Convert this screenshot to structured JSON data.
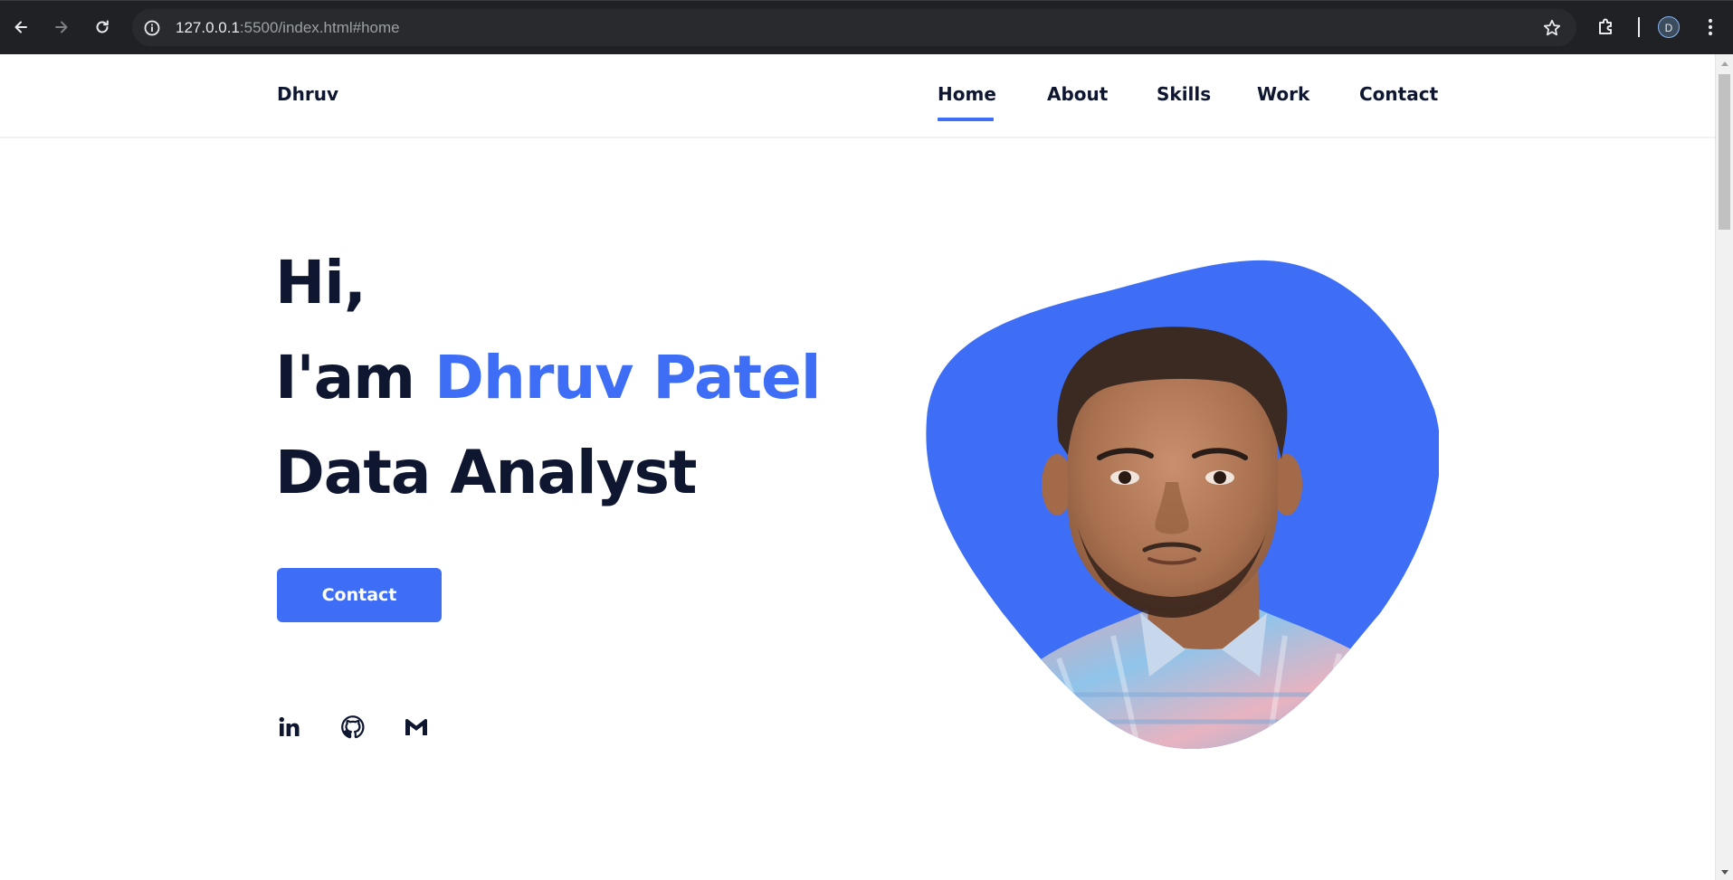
{
  "browser": {
    "url_host": "127.0.0.1",
    "url_rest": ":5500/index.html#home",
    "profile_initial": "D"
  },
  "site": {
    "logo": "Dhruv",
    "nav": [
      {
        "label": "Home",
        "active": true
      },
      {
        "label": "About",
        "active": false
      },
      {
        "label": "Skills",
        "active": false
      },
      {
        "label": "Work",
        "active": false
      },
      {
        "label": "Contact",
        "active": false
      }
    ]
  },
  "hero": {
    "greeting": "Hi,",
    "intro_prefix": "I'am ",
    "name": "Dhruv Patel",
    "role": "Data Analyst",
    "cta_label": "Contact",
    "social": [
      "linkedin-icon",
      "github-icon",
      "gmail-icon"
    ]
  },
  "colors": {
    "accent": "#3d6ef5",
    "text_dark": "#0e1630",
    "chrome_bg": "#202124"
  }
}
